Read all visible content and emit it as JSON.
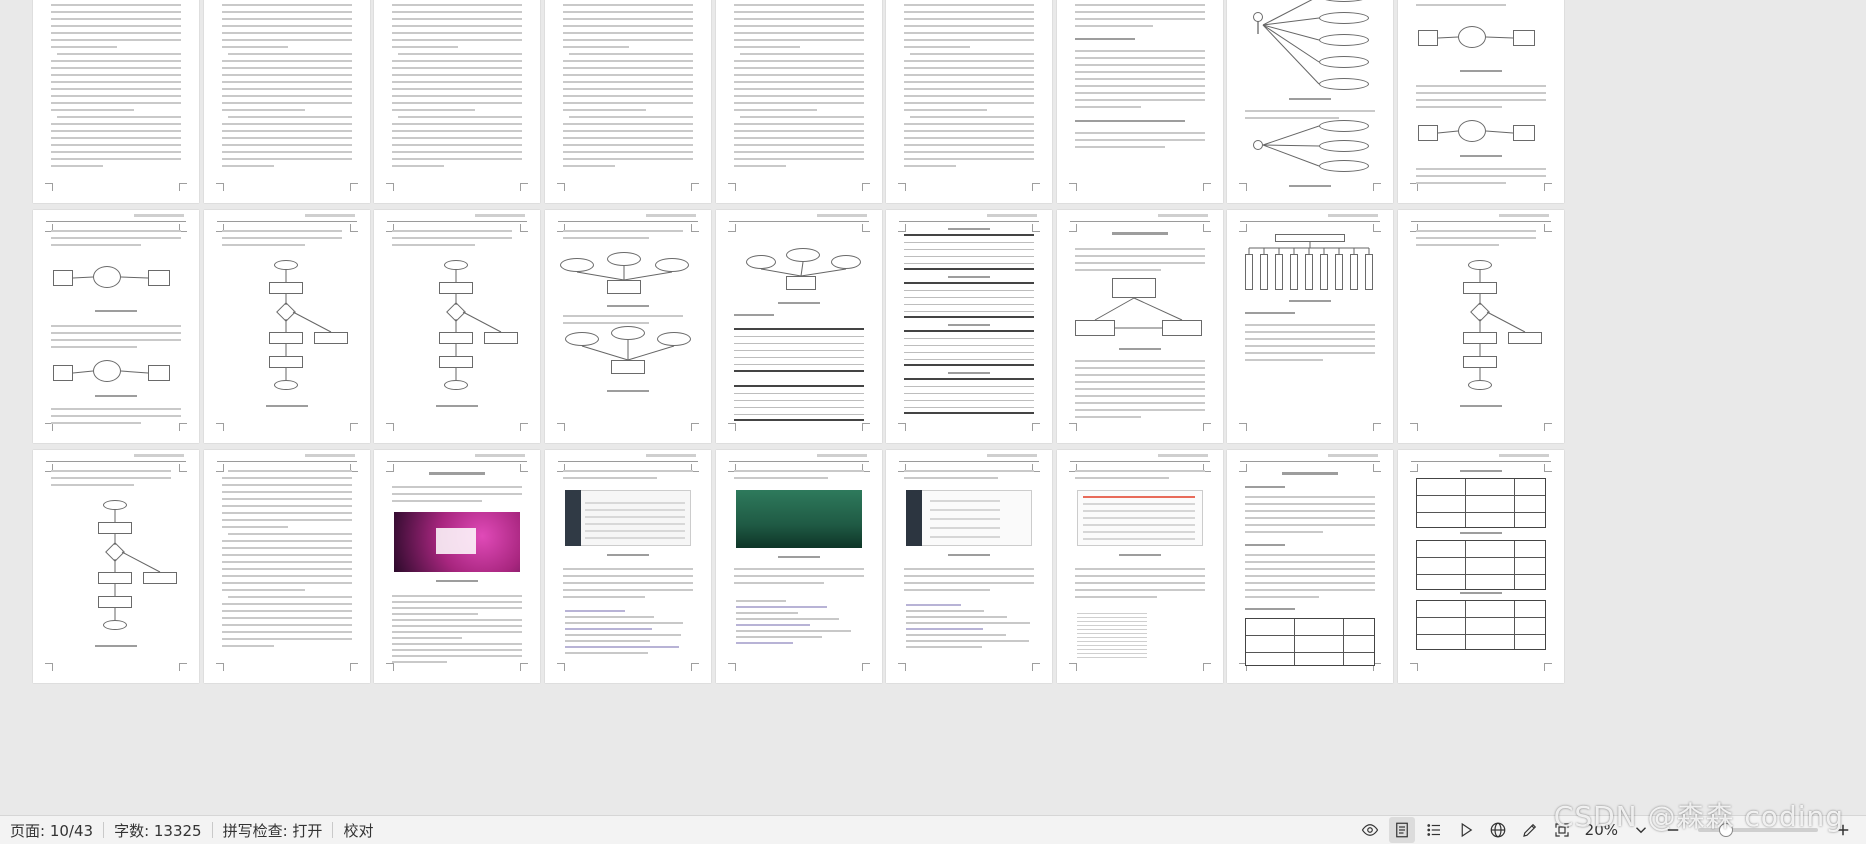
{
  "app": {
    "mode": "multi-page thumbnail view"
  },
  "pages": {
    "count": 43,
    "rows": [
      {
        "label": "row-1",
        "page_kinds": [
          "text",
          "text",
          "text",
          "text",
          "text",
          "text",
          "usecase",
          "usecase-diagram",
          "dataflow"
        ]
      },
      {
        "label": "row-2",
        "page_kinds": [
          "dataflow",
          "flowchart",
          "flowchart",
          "er-diagram",
          "er-table",
          "tables",
          "architecture",
          "tree",
          "flowchart"
        ]
      },
      {
        "label": "row-3",
        "page_kinds": [
          "flowchart",
          "text",
          "screenshot-login",
          "screenshot-admin",
          "screenshot-nature",
          "screenshot-form",
          "screenshot-list",
          "text-table",
          "tables"
        ]
      }
    ]
  },
  "statusbar": {
    "page_label": "页面: 10/43",
    "wordcount_label": "字数: 13325",
    "spellcheck_label": "拼写检查: 打开",
    "proofread_label": "校对",
    "zoom_label": "20%",
    "zoom_fraction": 0.2
  },
  "watermark": {
    "text": "CSDN @森森 coding"
  },
  "colors": {
    "background": "#e9e9e9",
    "page": "#ffffff",
    "statusbar": "#f3f3f3",
    "login_bg": "#a8267f",
    "nature_bg": "#1f5a44"
  }
}
